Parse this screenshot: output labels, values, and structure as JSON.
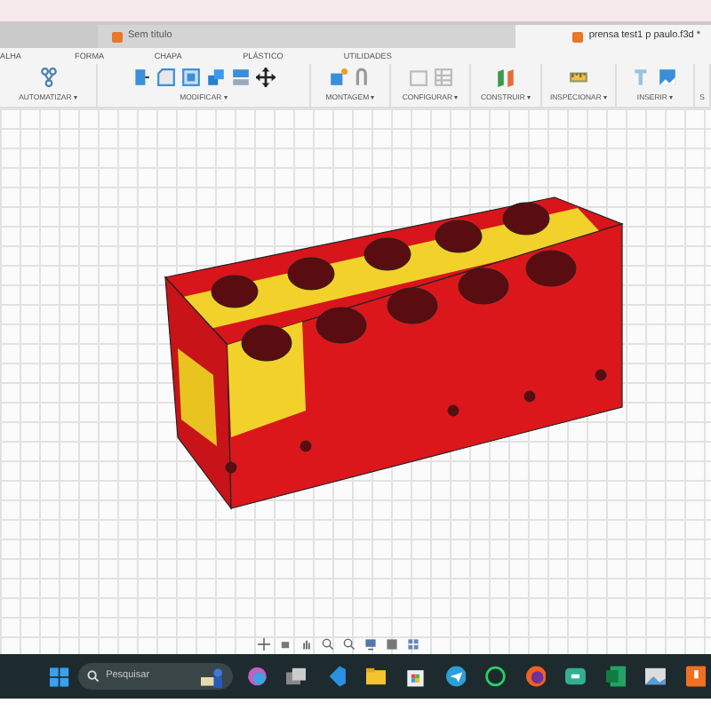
{
  "window": {
    "tabs": [
      {
        "label": "Sem título",
        "selected": false
      },
      {
        "label": "prensa test1 p paulo.f3d *",
        "selected": true
      }
    ]
  },
  "toolbar": {
    "tabs": [
      {
        "label": "ALHA"
      },
      {
        "label": "FORMA"
      },
      {
        "label": "CHAPA"
      },
      {
        "label": "PLÁSTICO"
      },
      {
        "label": "UTILIDADES"
      }
    ],
    "groups": [
      {
        "label": "AUTOMATIZAR ▾"
      },
      {
        "label": "MODIFICAR ▾"
      },
      {
        "label": "MONTAGEM ▾"
      },
      {
        "label": "CONFIGURAR ▾"
      },
      {
        "label": "CONSTRUIR ▾"
      },
      {
        "label": "INSPECIONAR ▾"
      },
      {
        "label": "INSERIR ▾"
      },
      {
        "label": "S"
      }
    ]
  },
  "taskbar": {
    "search": {
      "placeholder": "Pesquisar"
    }
  }
}
